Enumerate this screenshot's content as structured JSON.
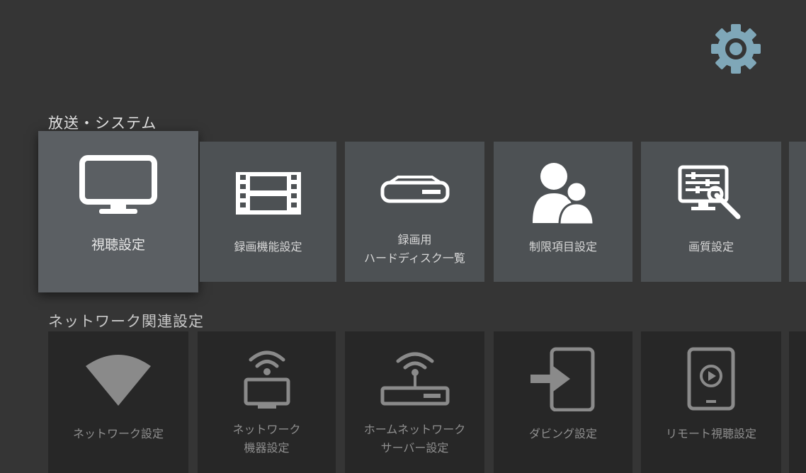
{
  "header": {
    "settings_icon": "gear-icon",
    "accent": "#7fa7b8"
  },
  "sections": {
    "broadcast": {
      "title": "放送・システム",
      "tiles": [
        {
          "label": "視聴設定",
          "icon": "tv-icon"
        },
        {
          "label": "録画機能設定",
          "icon": "film-icon"
        },
        {
          "label": "録画用",
          "label2": "ハードディスク一覧",
          "icon": "hard-disk-icon"
        },
        {
          "label": "制限項目設定",
          "icon": "users-icon"
        },
        {
          "label": "画質設定",
          "icon": "monitor-tools-icon"
        },
        {
          "label": "",
          "icon": "partial-tile"
        }
      ]
    },
    "network": {
      "title": "ネットワーク関連設定",
      "tiles": [
        {
          "label": "ネットワーク設定",
          "icon": "wifi-icon"
        },
        {
          "label": "ネットワーク",
          "label2": "機器設定",
          "icon": "wifi-tv-icon"
        },
        {
          "label": "ホームネットワーク",
          "label2": "サーバー設定",
          "icon": "router-icon"
        },
        {
          "label": "ダビング設定",
          "icon": "dubbing-icon"
        },
        {
          "label": "リモート視聴設定",
          "icon": "remote-view-icon"
        },
        {
          "label": "",
          "icon": "partial-tile"
        }
      ]
    }
  }
}
